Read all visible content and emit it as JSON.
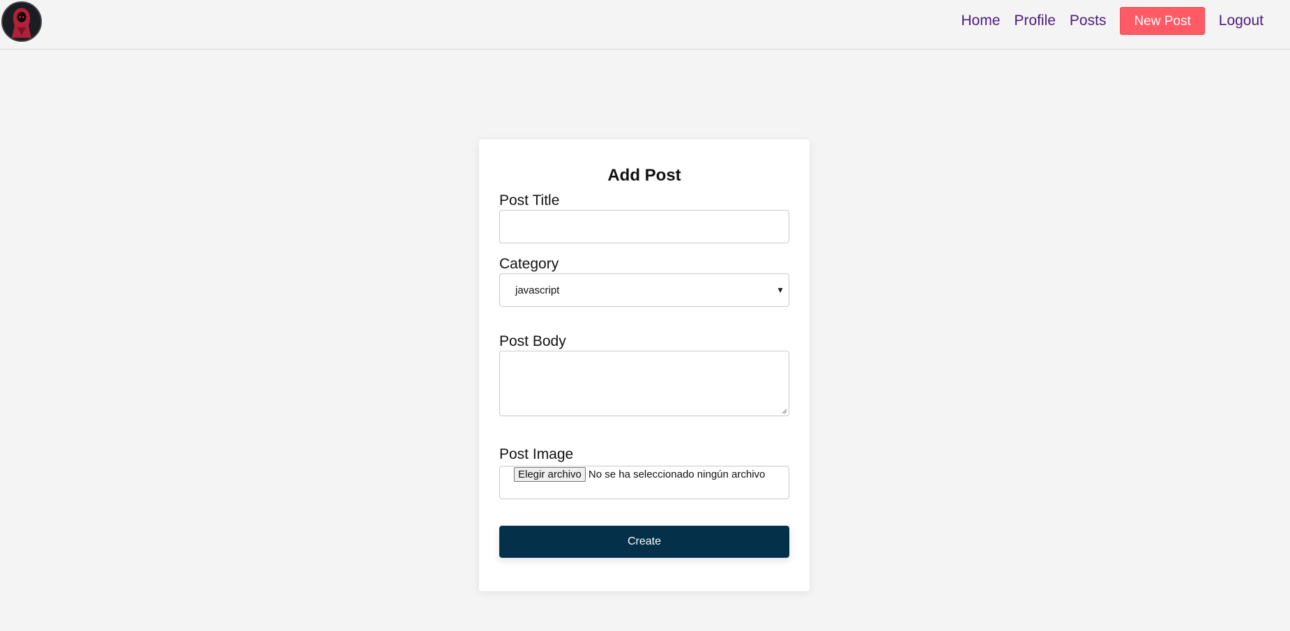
{
  "nav": {
    "links": [
      "Home",
      "Profile",
      "Posts"
    ],
    "new_post_label": "New Post",
    "logout_label": "Logout"
  },
  "form": {
    "title": "Add Post",
    "post_title_label": "Post Title",
    "post_title_value": "",
    "category_label": "Category",
    "category_selected": "javascript",
    "post_body_label": "Post Body",
    "post_body_value": "",
    "post_image_label": "Post Image",
    "file_button_label": "Elegir archivo",
    "file_status": "No se ha seleccionado ningún archivo",
    "submit_label": "Create"
  },
  "colors": {
    "link": "#4b1b80",
    "accent_button": "#ff5a66",
    "primary_button": "#04304a",
    "background": "#f4f4f4"
  }
}
